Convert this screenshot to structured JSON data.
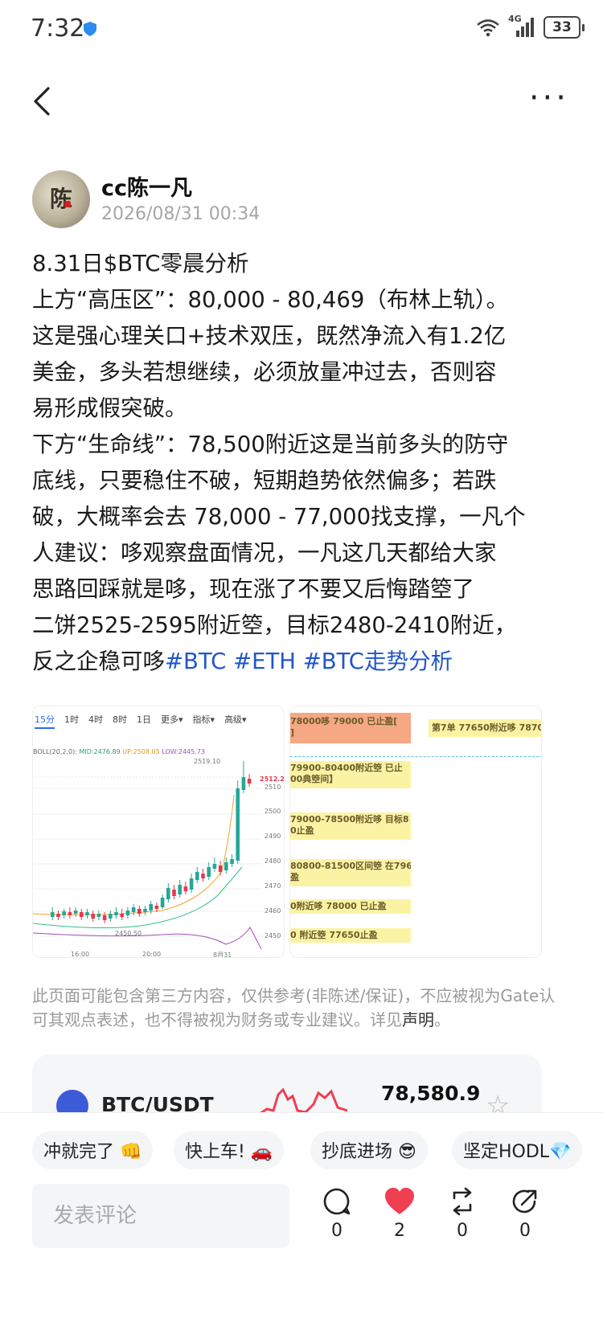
{
  "status": {
    "time": "7:32",
    "network": "4G",
    "battery": "33"
  },
  "author": {
    "name": "cc陈一凡",
    "timestamp": "2026/08/31 00:34",
    "avatar_glyph": "陈"
  },
  "post": {
    "lines": [
      "8.31日$BTC零晨分析",
      "上方“高压区”：80,000 - 80,469（布林上轨）。",
      "这是强心理关口+技术双压，既然净流入有1.2亿",
      "美金，多头若想继续，必须放量冲过去，否则容",
      "易形成假突破。",
      " 下方“生命线”：78,500附近这是当前多头的防守",
      "底线，只要稳住不破，短期趋势依然偏多；若跌",
      "破，大概率会去 78,000 - 77,000找支撑，一凡个",
      "人建议：哆观察盘面情况，一凡这几天都给大家",
      "思路回踩就是哆，现在涨了不要又后悔踏箜了",
      "二饼2525-2595附近箜，目标2480-2410附近，"
    ],
    "last_line_text": "反之企稳可哆",
    "hashtags": [
      "#BTC",
      "#ETH",
      "#BTC走势分析"
    ]
  },
  "chart_image": {
    "timeframes": [
      "15分",
      "1时",
      "4时",
      "8时",
      "1日",
      "更多▾",
      "指标▾",
      "高级▾"
    ],
    "boll": {
      "label": "BOLL(20,2,0):",
      "mid": "MID:2476.89",
      "up": "UP:2508.05",
      "low": "LOW:2445.73"
    },
    "y_ticks": [
      "2510",
      "2500",
      "2490",
      "2480",
      "2470",
      "2460",
      "2450"
    ],
    "x_ticks": [
      "16:00",
      "20:00",
      "8月31"
    ],
    "high_label": "2519.10",
    "low_label": "2450.50",
    "price_tag": "2512.24"
  },
  "notes_image": {
    "rows": [
      {
        "l1": "78000哆  79000  已止盈[",
        "l2": "]"
      },
      {
        "l1": "79900-80400附近箜  已止",
        "l2": "00典箜间】"
      },
      {
        "l1": "79000-78500附近哆 目标8",
        "l2": "0止盈"
      },
      {
        "l1": "80800-81500区间箜 在796",
        "l2": "盈"
      },
      {
        "l1": "0附近哆 78000  已止盈",
        "l2": ""
      },
      {
        "l1": "0 附近箜 77650止盈",
        "l2": ""
      }
    ],
    "side_note": "第7单 77650附近哆 7870"
  },
  "disclaimer": {
    "text": "此页面可能包含第三方内容，仅供参考(非陈述/保证)，不应被视为Gate认可其观点表述，也不得被视为财务或专业建议。详见",
    "link": "声明",
    "end": "。"
  },
  "ticker": {
    "pair": "BTC/USDT",
    "price": "78,580.9"
  },
  "chips": [
    "冲就完了 👊",
    "快上车! 🚗",
    "抄底进场 😎",
    "坚定HODL💎"
  ],
  "comment_placeholder": "发表评论",
  "actions": {
    "comment_count": "0",
    "like_count": "2",
    "repost_count": "0",
    "share_count": "0"
  },
  "colors": {
    "hashtag": "#2156c9",
    "up_candle": "#26a69a",
    "down_candle": "#e53950",
    "like": "#f03e52",
    "highlight": "#fbf3a4",
    "salmon": "#f5a882"
  }
}
